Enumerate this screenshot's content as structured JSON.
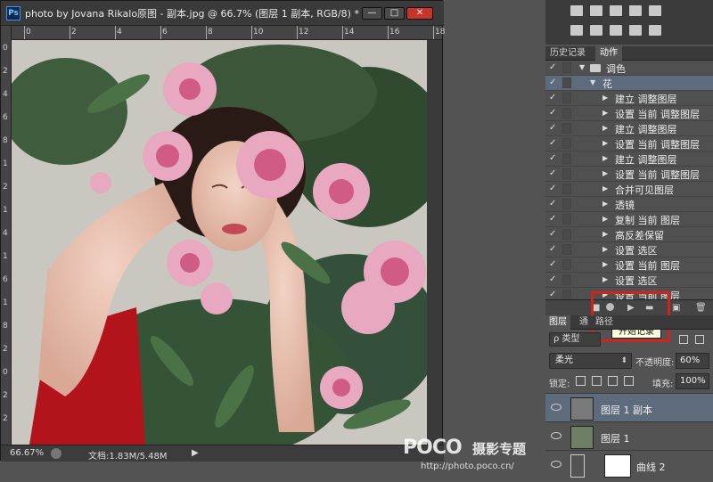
{
  "document": {
    "title": "photo by Jovana Rikalo原图 - 副本.jpg @ 66.7% (图层 1 副本, RGB/8) *",
    "app_logo": "Ps",
    "window_buttons": {
      "minimize": "—",
      "maximize": "□",
      "close": "✕"
    },
    "ruler_top": [
      "0",
      "2",
      "4",
      "6",
      "8",
      "10",
      "12",
      "14",
      "16",
      "18"
    ],
    "ruler_left": [
      "0",
      "2",
      "4",
      "6",
      "8",
      "1",
      "2",
      "1",
      "4",
      "1",
      "6",
      "1",
      "8",
      "2",
      "0",
      "2",
      "2"
    ],
    "status": {
      "zoom": "66.67%",
      "doc_info": "文档:1.83M/5.48M",
      "arrow": "▶"
    }
  },
  "history_actions_panel": {
    "tabs": [
      "历史记录",
      "动作"
    ],
    "active_tab": "动作",
    "rows": [
      {
        "label": "调色",
        "type": "set",
        "checked": true
      },
      {
        "label": "花",
        "type": "action",
        "checked": true
      },
      {
        "label": "建立 调整图层",
        "type": "step",
        "checked": true
      },
      {
        "label": "设置 当前 调整图层",
        "type": "step",
        "checked": true
      },
      {
        "label": "建立 调整图层",
        "type": "step",
        "checked": true
      },
      {
        "label": "设置 当前 调整图层",
        "type": "step",
        "checked": true
      },
      {
        "label": "建立 调整图层",
        "type": "step",
        "checked": true
      },
      {
        "label": "设置 当前 调整图层",
        "type": "step",
        "checked": true
      },
      {
        "label": "合并可见图层",
        "type": "step",
        "checked": true
      },
      {
        "label": "透镜",
        "type": "step",
        "checked": true
      },
      {
        "label": "复制 当前 图层",
        "type": "step",
        "checked": true
      },
      {
        "label": "高反差保留",
        "type": "step",
        "checked": true
      },
      {
        "label": "设置 选区",
        "type": "step",
        "checked": true
      },
      {
        "label": "设置 当前 图层",
        "type": "step",
        "checked": true
      },
      {
        "label": "设置 选区",
        "type": "step",
        "checked": true
      },
      {
        "label": "设置 当前 图层",
        "type": "step",
        "checked": true
      }
    ],
    "check_glyph": "✓",
    "tooltip": "开始记录",
    "highlight_color": "#d0231c"
  },
  "layers_panel": {
    "tabs": [
      "图层",
      "通",
      "路径"
    ],
    "active_tab": "图层",
    "filter_label": "ρ 类型",
    "blend_mode": "柔光",
    "opacity_label": "不透明度:",
    "opacity_value": "60%",
    "lock_label": "锁定:",
    "fill_label": "填充:",
    "fill_value": "100%",
    "layers": [
      {
        "name": "图层 1 副本",
        "selected": true,
        "thumb": "gray"
      },
      {
        "name": "图层 1",
        "selected": false,
        "thumb": "photo"
      },
      {
        "name": "曲线 2",
        "selected": false,
        "thumb": "adjust"
      }
    ]
  },
  "watermark": {
    "logo": "POCO",
    "title": "摄影专题",
    "url": "http://photo.poco.cn/"
  }
}
